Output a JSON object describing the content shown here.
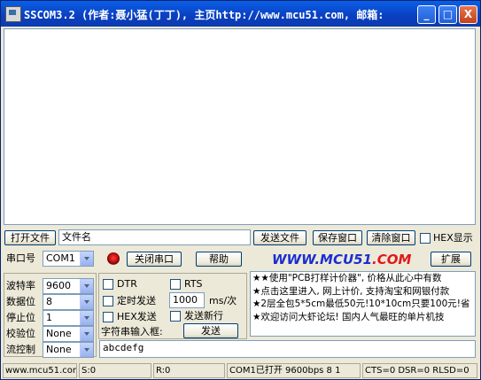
{
  "window": {
    "title": "SSCOM3.2 (作者:聂小猛(丁丁), 主页http://www.mcu51.com, 邮箱:",
    "min": "_",
    "max": "□",
    "close": "X"
  },
  "toolbar1": {
    "open_file": "打开文件",
    "filename": "文件名",
    "send_file": "发送文件",
    "save_window": "保存窗口",
    "clear_window": "清除窗口",
    "hex_display": "HEX显示"
  },
  "toolbar2": {
    "port_label": "串口号",
    "port_value": "COM1",
    "close_port": "关闭串口",
    "help": "帮助",
    "logo_main": "WWW.MCU51",
    "logo_dot": ".COM",
    "expand": "扩展"
  },
  "settings": {
    "baud_label": "波特率",
    "baud_value": "9600",
    "databits_label": "数据位",
    "databits_value": "8",
    "stopbits_label": "停止位",
    "stopbits_value": "1",
    "parity_label": "校验位",
    "parity_value": "None",
    "flow_label": "流控制",
    "flow_value": "None"
  },
  "options": {
    "dtr": "DTR",
    "rts": "RTS",
    "timed_send": "定时发送",
    "interval": "1000",
    "interval_unit": "ms/次",
    "hex_send": "HEX发送",
    "send_newline": "发送新行",
    "input_label": "字符串输入框:",
    "send": "发送"
  },
  "send_text": "abcdefg",
  "ads": [
    "★★使用\"PCB打样计价器\", 价格从此心中有数",
    "★点击这里进入, 网上计价, 支持淘宝和网银付款",
    "★2层全包5*5cm最低50元!10*10cm只要100元!省",
    "★欢迎访问大虾论坛! 国内人气最旺的单片机技"
  ],
  "status": {
    "site": "www.mcu51.com",
    "sent": "S:0",
    "recv": "R:0",
    "port_state": "COM1已打开  9600bps  8 1",
    "signals": "CTS=0 DSR=0 RLSD=0"
  }
}
